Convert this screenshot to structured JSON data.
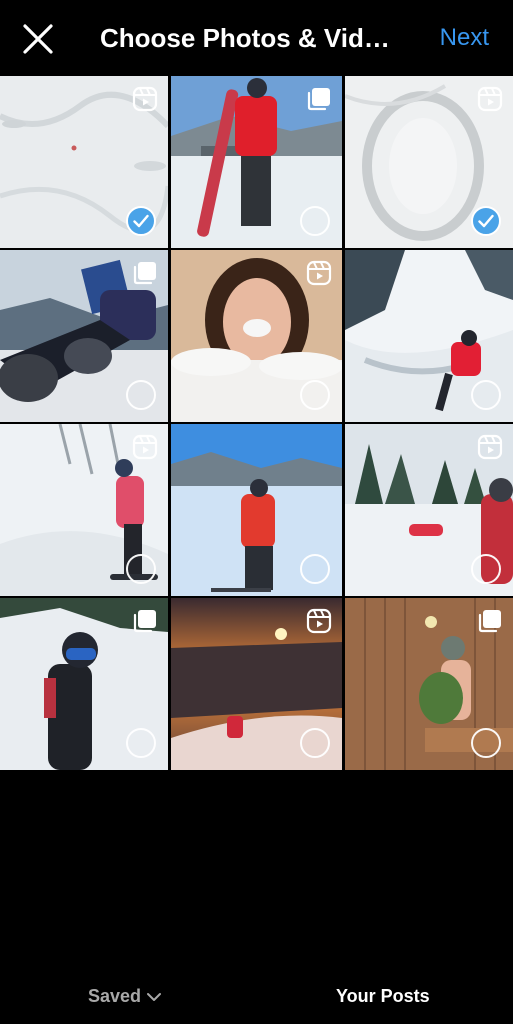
{
  "header": {
    "close_icon": "close-icon",
    "title": "Choose Photos & Videos",
    "next_label": "Next"
  },
  "colors": {
    "accent": "#3897f0",
    "check": "#4aa3e8",
    "background": "#000000"
  },
  "media": [
    {
      "type": "reel",
      "badge_icon": "reels-icon",
      "selected": true
    },
    {
      "type": "carousel",
      "badge_icon": "multiple-icon",
      "selected": false
    },
    {
      "type": "reel",
      "badge_icon": "reels-icon",
      "selected": true
    },
    {
      "type": "carousel",
      "badge_icon": "multiple-icon",
      "selected": false
    },
    {
      "type": "reel",
      "badge_icon": "reels-icon",
      "selected": false
    },
    {
      "type": "photo",
      "badge_icon": "",
      "selected": false
    },
    {
      "type": "reel",
      "badge_icon": "reels-icon",
      "selected": false
    },
    {
      "type": "photo",
      "badge_icon": "",
      "selected": false
    },
    {
      "type": "reel",
      "badge_icon": "reels-icon",
      "selected": false
    },
    {
      "type": "carousel",
      "badge_icon": "multiple-icon",
      "selected": false
    },
    {
      "type": "reel",
      "badge_icon": "reels-icon",
      "selected": false
    },
    {
      "type": "carousel",
      "badge_icon": "multiple-icon",
      "selected": false
    }
  ],
  "footer": {
    "saved_label": "Saved",
    "saved_icon": "chevron-down-icon",
    "your_posts_label": "Your Posts"
  }
}
